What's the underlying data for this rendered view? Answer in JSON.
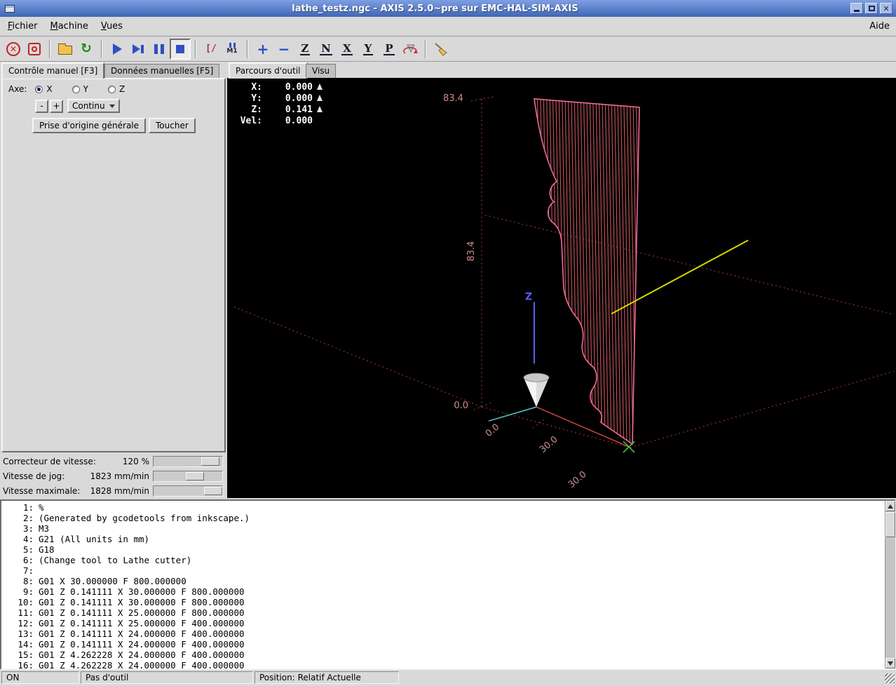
{
  "titlebar": {
    "title": "lathe_testz.ngc - AXIS 2.5.0~pre sur EMC-HAL-SIM-AXIS"
  },
  "menubar": {
    "items": [
      {
        "u": "F",
        "rest": "ichier"
      },
      {
        "u": "M",
        "rest": "achine"
      },
      {
        "u": "V",
        "rest": "ues"
      }
    ],
    "help": "Aide"
  },
  "toolbar": {
    "icons": [
      "estop-icon",
      "machine-power-icon",
      "open-file-icon",
      "reload-icon",
      "run-icon",
      "step-icon",
      "pause-icon",
      "stop-icon",
      "skip-lines-icon",
      "optional-pause-m1-icon",
      "zoom-in-icon",
      "zoom-out-icon",
      "view-top-icon",
      "view-rotated-top-icon",
      "view-side-icon",
      "view-front-icon",
      "view-perspective-icon",
      "rotate-view-icon",
      "clear-plot-icon"
    ],
    "letters": {
      "skip": "[/",
      "m1": "M1",
      "zoom_in": "+",
      "zoom_out": "−",
      "top": "Z",
      "rotated": "N",
      "side": "X",
      "front": "Y",
      "perspective": "P"
    }
  },
  "manual": {
    "tab_manual": "Contrôle manuel [F3]",
    "tab_mdi": "Données manuelles [F5]",
    "axis_label": "Axe:",
    "axes": [
      "X",
      "Y",
      "Z"
    ],
    "selected_axis": "X",
    "jog_minus": "-",
    "jog_plus": "+",
    "jog_mode": "Continu",
    "home_all": "Prise d'origine générale",
    "touch_off": "Toucher"
  },
  "sliders": [
    {
      "label": "Correcteur de vitesse:",
      "value": "120 %"
    },
    {
      "label": "Vitesse de jog:",
      "value": "1823 mm/min"
    },
    {
      "label": "Vitesse maximale:",
      "value": "1828 mm/min"
    }
  ],
  "preview": {
    "tab_preview": "Parcours d'outil",
    "tab_dro": "Visu",
    "dro": [
      {
        "label": "X:",
        "value": "0.000",
        "homed": true
      },
      {
        "label": "Y:",
        "value": "0.000",
        "homed": true
      },
      {
        "label": "Z:",
        "value": "0.141",
        "homed": true
      },
      {
        "label": "Vel:",
        "value": "0.000",
        "homed": false
      }
    ],
    "dims": {
      "height_top": "83.4",
      "height_side": "83.4",
      "zero_left": "0.0",
      "bottom": [
        "0.0",
        "30.0",
        "30.0"
      ],
      "z_axis": "Z"
    }
  },
  "gcode": {
    "lines": [
      {
        "num": "1:",
        "text": "%"
      },
      {
        "num": "2:",
        "text": "(Generated by gcodetools from inkscape.)"
      },
      {
        "num": "3:",
        "text": "M3"
      },
      {
        "num": "4:",
        "text": "G21 (All units in mm)"
      },
      {
        "num": "5:",
        "text": "G18"
      },
      {
        "num": "6:",
        "text": "(Change tool to Lathe cutter)"
      },
      {
        "num": "7:",
        "text": ""
      },
      {
        "num": "8:",
        "text": "G01 X 30.000000 F 800.000000"
      },
      {
        "num": "9:",
        "text": "G01 Z 0.141111 X 30.000000 F 800.000000"
      },
      {
        "num": "10:",
        "text": "G01 Z 0.141111 X 30.000000 F 800.000000"
      },
      {
        "num": "11:",
        "text": "G01 Z 0.141111 X 25.000000 F 800.000000"
      },
      {
        "num": "12:",
        "text": "G01 Z 0.141111 X 25.000000 F 400.000000"
      },
      {
        "num": "13:",
        "text": "G01 Z 0.141111 X 24.000000 F 400.000000"
      },
      {
        "num": "14:",
        "text": "G01 Z 0.141111 X 24.000000 F 400.000000"
      },
      {
        "num": "15:",
        "text": "G01 Z 4.262228 X 24.000000 F 400.000000"
      },
      {
        "num": "16:",
        "text": "G01 Z 4.262228 X 24.000000 F 400.000000"
      }
    ]
  },
  "statusbar": {
    "state": "ON",
    "tool": "Pas d'outil",
    "position": "Position: Relatif Actuelle"
  },
  "colors": {
    "toolpath_outline": "#f06a9a",
    "toolpath_hatch": "#c9595e",
    "extents_dotted": "#8f3434",
    "dimension_text": "#d08c8c",
    "axis_yellow": "#d8d800",
    "axis_blue": "#5b5bff",
    "axis_red": "#cc4444",
    "axis_cyan": "#55cccc",
    "origin_green": "#44cc44"
  }
}
